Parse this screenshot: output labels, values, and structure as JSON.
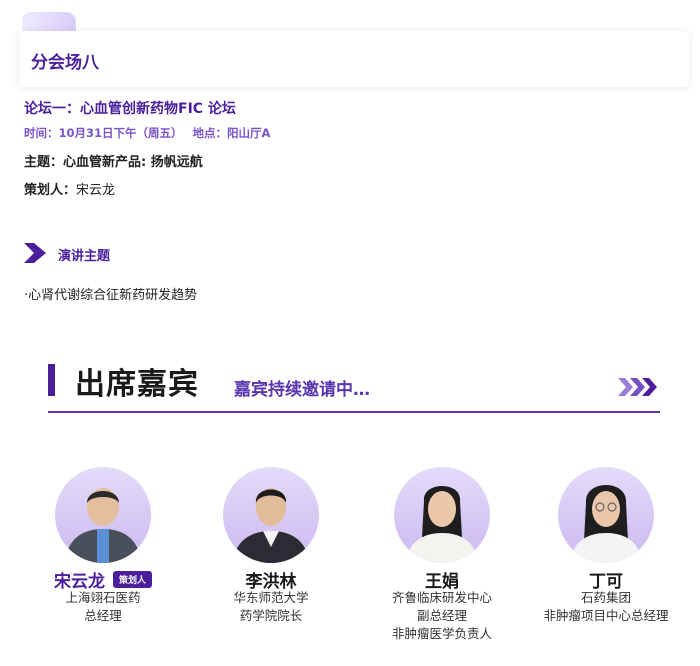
{
  "session": {
    "title": "分会场八"
  },
  "forum": {
    "title": "论坛一：心血管创新药物FIC 论坛",
    "time": "时间：10月31日下午（周五）",
    "venue": "地点：阳山厅A",
    "theme_label": "主题：",
    "theme_value": "心血管新产品: 扬帆远航",
    "planner_label": "策划人：",
    "planner_value": "宋云龙"
  },
  "speech": {
    "heading": "演讲主题",
    "topics": [
      "·心肾代谢综合征新药研发趋势"
    ]
  },
  "guests_section": {
    "title": "出席嘉宾",
    "subtitle": "嘉宾持续邀请中…"
  },
  "guests": [
    {
      "name": "宋云龙",
      "badge": "策划人",
      "lines": [
        "上海翊石医药",
        "总经理"
      ]
    },
    {
      "name": "李洪林",
      "lines": [
        "华东师范大学",
        "药学院院长"
      ]
    },
    {
      "name": "王娟",
      "lines": [
        "齐鲁临床研发中心",
        "副总经理",
        "非肿瘤医学负责人"
      ]
    },
    {
      "name": "丁可",
      "lines": [
        "石药集团",
        "非肿瘤项目中心总经理"
      ]
    }
  ],
  "colors": {
    "accent": "#4b1f9c",
    "accent_light": "#7a53c8"
  }
}
